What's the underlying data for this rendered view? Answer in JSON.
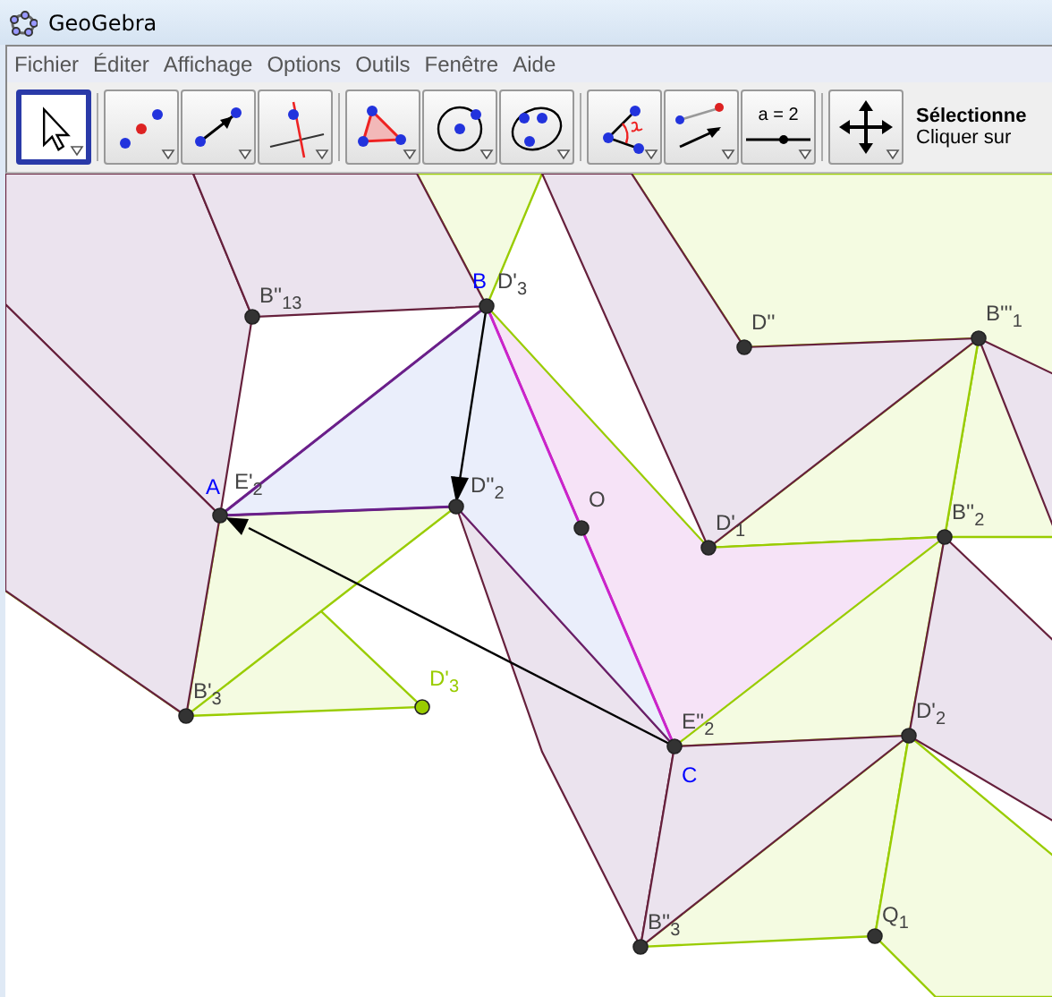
{
  "window": {
    "title": "GeoGebra"
  },
  "menu": [
    "Fichier",
    "Éditer",
    "Affichage",
    "Options",
    "Outils",
    "Fenêtre",
    "Aide"
  ],
  "tools": [
    {
      "kind": "select",
      "selected": true
    },
    {
      "kind": "point",
      "selected": false
    },
    {
      "kind": "line",
      "selected": false
    },
    {
      "kind": "perpendicular",
      "selected": false
    },
    {
      "kind": "polygon",
      "selected": false
    },
    {
      "kind": "circle",
      "selected": false
    },
    {
      "kind": "conic",
      "selected": false
    },
    {
      "kind": "angle",
      "selected": false
    },
    {
      "kind": "vector",
      "selected": false
    },
    {
      "kind": "slider",
      "label": "a = 2",
      "selected": false
    },
    {
      "kind": "move",
      "selected": false
    }
  ],
  "tool_help": {
    "title": "Sélectionne",
    "text": "Cliquer sur"
  },
  "points": [
    {
      "color": "#333333",
      "labels": [
        {
          "text": "B''$_{13}$",
          "color": "#444444"
        }
      ]
    },
    {
      "color": "#333333",
      "labels": [
        {
          "text": "B",
          "color": "#0000ff"
        },
        {
          "text": "D'$_{3}$",
          "color": "#444444"
        }
      ]
    },
    {
      "color": "#333333",
      "labels": [
        {
          "text": "D''",
          "color": "#444444"
        }
      ]
    },
    {
      "color": "#333333",
      "labels": [
        {
          "text": "B'''$_{1}$",
          "color": "#444444"
        }
      ]
    },
    {
      "color": "#333333",
      "labels": [
        {
          "text": "A",
          "color": "#0000ff"
        },
        {
          "text": "E'$_{2}$",
          "color": "#444444"
        }
      ]
    },
    {
      "color": "#333333",
      "labels": [
        {
          "text": "D''$_{2}$",
          "color": "#444444"
        }
      ]
    },
    {
      "color": "#333333",
      "labels": [
        {
          "text": "O",
          "color": "#444444"
        }
      ]
    },
    {
      "color": "#333333",
      "labels": [
        {
          "text": "D'$_{1}$",
          "color": "#444444"
        }
      ]
    },
    {
      "color": "#333333",
      "labels": [
        {
          "text": "B''$_{2}$",
          "color": "#444444"
        }
      ]
    },
    {
      "color": "#333333",
      "labels": [
        {
          "text": "B'$_{3}$",
          "color": "#444444"
        }
      ]
    },
    {
      "color": "#99cc00",
      "labels": [
        {
          "text": "D'$_{3}$",
          "color": "#99cc00"
        }
      ]
    },
    {
      "color": "#333333",
      "labels": [
        {
          "text": "E''$_{2}$",
          "color": "#444444"
        },
        {
          "text": "C",
          "color": "#0000ff"
        }
      ]
    },
    {
      "color": "#333333",
      "labels": [
        {
          "text": "D'$_{2}$",
          "color": "#444444"
        }
      ]
    },
    {
      "color": "#333333",
      "labels": [
        {
          "text": "B''$_{3}$",
          "color": "#444444"
        }
      ]
    },
    {
      "color": "#333333",
      "labels": [
        {
          "text": "Q$_{1}$",
          "color": "#444444"
        }
      ]
    }
  ]
}
